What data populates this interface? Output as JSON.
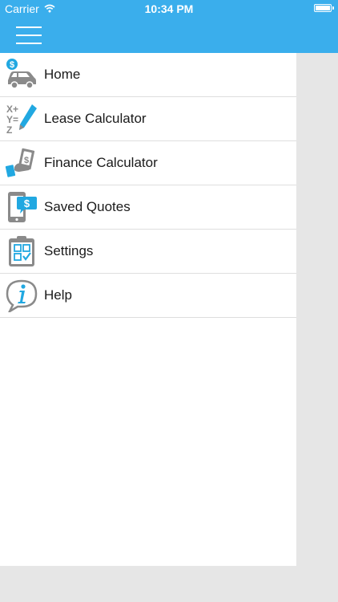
{
  "status_bar": {
    "carrier": "Carrier",
    "time": "10:34 PM",
    "wifi_icon": "wifi-icon",
    "battery_level": 1.0
  },
  "nav_bar": {
    "menu_icon": "hamburger-menu-icon",
    "color": "#3aaeec"
  },
  "menu": {
    "items": [
      {
        "label": "Home",
        "icon": "car-dollar-icon"
      },
      {
        "label": "Lease Calculator",
        "icon": "math-pencil-icon"
      },
      {
        "label": "Finance Calculator",
        "icon": "hand-money-icon"
      },
      {
        "label": "Saved Quotes",
        "icon": "phone-dollar-chat-icon"
      },
      {
        "label": "Settings",
        "icon": "clipboard-checklist-icon"
      },
      {
        "label": "Help",
        "icon": "info-bubble-icon"
      }
    ]
  },
  "colors": {
    "accent": "#3aaeec",
    "icon_gray": "#8a8a8a",
    "icon_blue": "#21a8e1"
  }
}
